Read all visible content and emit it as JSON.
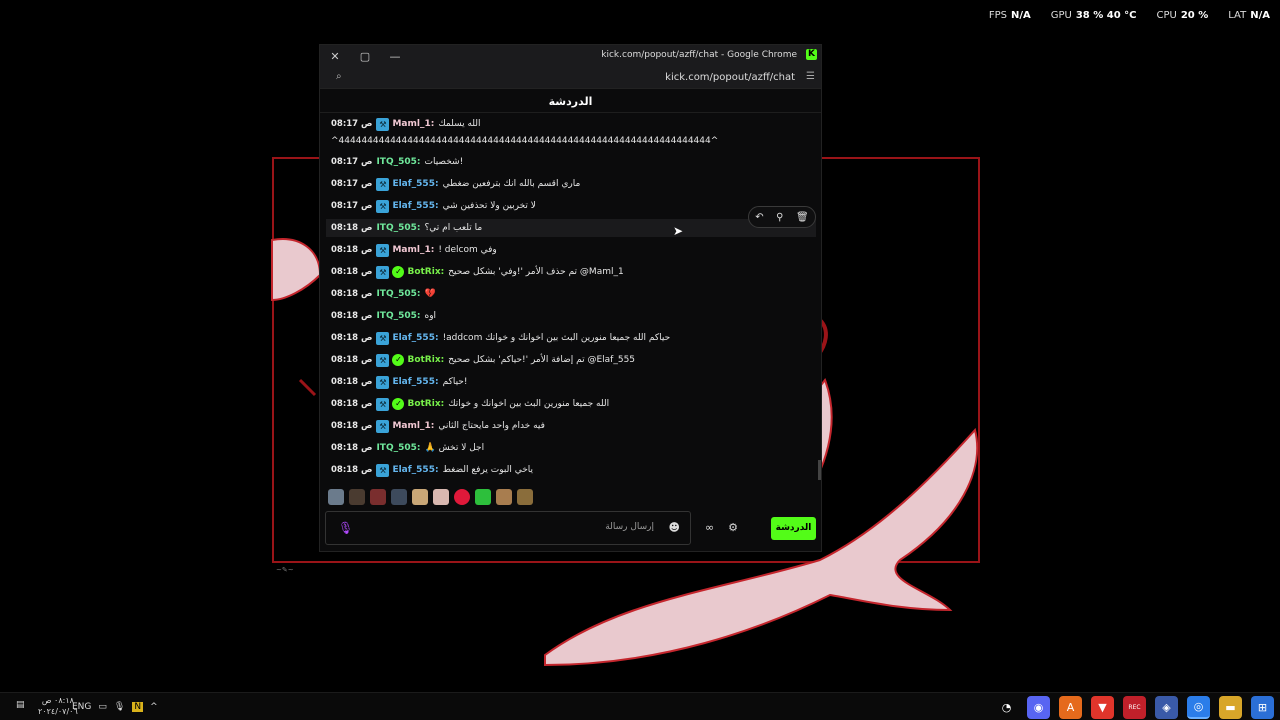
{
  "overlay": {
    "fps_label": "FPS",
    "fps_value": "N/A",
    "gpu_label": "GPU",
    "gpu_value": "38 % 40 °C",
    "cpu_label": "CPU",
    "cpu_value": "20 %",
    "lat_label": "LAT",
    "lat_value": "N/A"
  },
  "window": {
    "title": "kick.com/popout/azff/chat - Google Chrome",
    "url": "kick.com/popout/azff/chat",
    "header": "الدردشة"
  },
  "messages": [
    {
      "time": "08:17 ص",
      "user": "Maml_1:",
      "text": "الله يسلمك",
      "color": "u-pink",
      "badge": "mod"
    },
    {
      "time": "",
      "user": "",
      "text": "^44444444444444444444444444444444444444444444444444444444444444444^",
      "color": "",
      "badge": "none"
    },
    {
      "time": "08:17 ص",
      "user": "ITQ_505:",
      "text": "شخصيات!",
      "color": "u-green",
      "badge": "none"
    },
    {
      "time": "08:17 ص",
      "user": "Elaf_555:",
      "text": "ماري اقسم بالله انك بترفعين ضغطي",
      "color": "u-blue",
      "badge": "mod"
    },
    {
      "time": "08:17 ص",
      "user": "Elaf_555:",
      "text": "لا تخربين ولا تحذفين شي",
      "color": "u-blue",
      "badge": "mod"
    },
    {
      "time": "08:18 ص",
      "user": "ITQ_505:",
      "text": "ما تلعب ام تي؟",
      "color": "u-green",
      "badge": "none"
    },
    {
      "time": "08:18 ص",
      "user": "Maml_1:",
      "text": "! delcom وفي",
      "color": "u-pink",
      "badge": "mod"
    },
    {
      "time": "08:18 ص",
      "user": "BotRix:",
      "text": "تم حذف الأمر '!وفي' بشكل صحيح @Maml_1",
      "color": "u-lime",
      "badge": "bot"
    },
    {
      "time": "08:18 ص",
      "user": "ITQ_505:",
      "text": "💔",
      "color": "u-green",
      "badge": "none"
    },
    {
      "time": "08:18 ص",
      "user": "ITQ_505:",
      "text": "اوه",
      "color": "u-green",
      "badge": "none"
    },
    {
      "time": "08:18 ص",
      "user": "Elaf_555:",
      "text": "!addcom حياكم الله جميعا منورين البث بين اخوانك و خواتك",
      "color": "u-blue",
      "badge": "mod"
    },
    {
      "time": "08:18 ص",
      "user": "BotRix:",
      "text": "تم إضافة الأمر '!حياكم' بشكل صحيح @Elaf_555",
      "color": "u-lime",
      "badge": "bot"
    },
    {
      "time": "08:18 ص",
      "user": "Elaf_555:",
      "text": "حياكم!",
      "color": "u-blue",
      "badge": "mod"
    },
    {
      "time": "08:18 ص",
      "user": "BotRix:",
      "text": "الله جميعا منورين البث بين اخوانك و خواتك",
      "color": "u-lime",
      "badge": "bot"
    },
    {
      "time": "08:18 ص",
      "user": "Maml_1:",
      "text": "فيه خدام واحد مايحتاج الثاني",
      "color": "u-pink",
      "badge": "mod"
    },
    {
      "time": "08:18 ص",
      "user": "ITQ_505:",
      "text": "🙏 اجل لا تخش",
      "color": "u-green",
      "badge": "none"
    },
    {
      "time": "08:18 ص",
      "user": "Elaf_555:",
      "text": "ياخي البوت يرفع الضغط",
      "color": "u-blue",
      "badge": "mod"
    }
  ],
  "input": {
    "placeholder": "إرسال رسالة"
  },
  "chat_button": "الدردشة",
  "taskbar": {
    "lang": "ENG",
    "time": "٠٨:١٨ ص",
    "date": "٢٠٢٤/٠٧/٠٦"
  },
  "colors": {
    "kick_green": "#53fc18",
    "wallpaper_red": "#9a1418"
  }
}
